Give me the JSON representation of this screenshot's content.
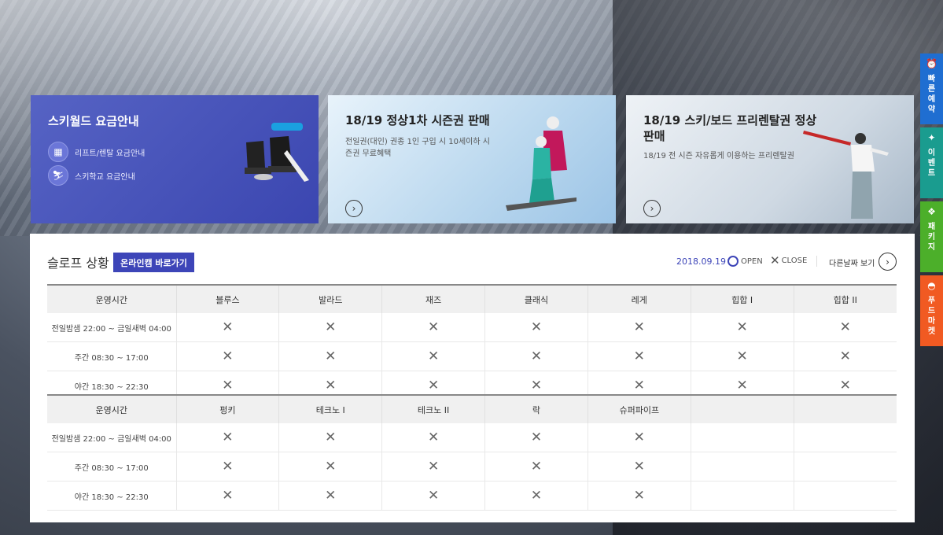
{
  "cards": [
    {
      "title": "스키월드 요금안내",
      "links": [
        {
          "icon": "lift-icon",
          "label": "리프트/렌탈 요금안내"
        },
        {
          "icon": "skier-icon",
          "label": "스키학교 요금안내"
        }
      ]
    },
    {
      "title": "18/19 정상1차 시즌권 판매",
      "desc": "전일권(대인) 권종 1인 구입 시 10세이하 시즌권 무료혜택"
    },
    {
      "title": "18/19 스키/보드 프리렌탈권 정상 판매",
      "desc": "18/19 전 시즌 자유롭게 이용하는 프리렌탈권"
    }
  ],
  "slope": {
    "title": "슬로프 상황",
    "cam_button": "온라인캠 바로가기",
    "date": "2018.09.19",
    "open_label": "OPEN",
    "close_label": "CLOSE",
    "other_day": "다른날짜 보기",
    "row_header": "운영시간",
    "times": [
      "전일밤샘 22:00 ~ 금일새벽 04:00",
      "주간 08:30 ~ 17:00",
      "야간 18:30 ~ 22:30"
    ],
    "table1_cols": [
      "블루스",
      "발라드",
      "재즈",
      "클래식",
      "레게",
      "힙합 I",
      "힙합 II"
    ],
    "table2_cols": [
      "펑키",
      "테크노 I",
      "테크노 II",
      "락",
      "슈퍼파이프",
      "",
      ""
    ],
    "status_symbol": "✕"
  },
  "quick_menu": [
    {
      "icon": "alarm-icon",
      "label": "빠른예약",
      "color": "#1f6ed1"
    },
    {
      "icon": "event-icon",
      "label": "이벤트",
      "color": "#1a9c8f"
    },
    {
      "icon": "gift-icon",
      "label": "패키지",
      "color": "#4caf2a"
    },
    {
      "icon": "food-icon",
      "label": "푸드마켓",
      "color": "#f15a22"
    }
  ]
}
